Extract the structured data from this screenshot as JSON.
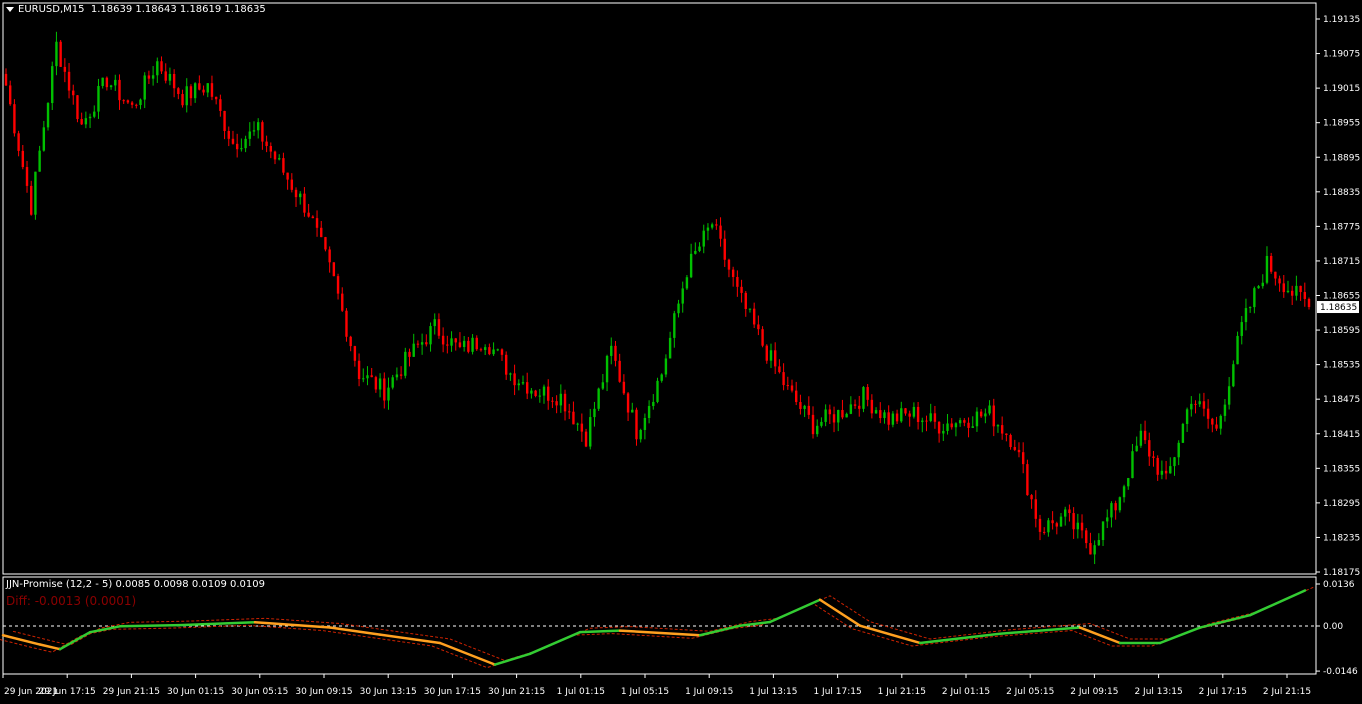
{
  "chart": {
    "symbol_line": "EURUSD,M15  1.18639 1.18643 1.18619 1.18635",
    "current_price_label": "1.18635",
    "price_axis_labels": [
      "1.19135",
      "1.19075",
      "1.19015",
      "1.18955",
      "1.18895",
      "1.18835",
      "1.18775",
      "1.18715",
      "1.18655",
      "1.18595",
      "1.18535",
      "1.18475",
      "1.18415",
      "1.18355",
      "1.18295",
      "1.18235",
      "1.18175"
    ],
    "time_axis_labels": [
      "29 Jun 2021",
      "29 Jun 17:15",
      "29 Jun 21:15",
      "30 Jun 01:15",
      "30 Jun 05:15",
      "30 Jun 09:15",
      "30 Jun 13:15",
      "30 Jun 17:15",
      "30 Jun 21:15",
      "1 Jul 01:15",
      "1 Jul 05:15",
      "1 Jul 09:15",
      "1 Jul 13:15",
      "1 Jul 17:15",
      "1 Jul 21:15",
      "2 Jul 01:15",
      "2 Jul 05:15",
      "2 Jul 09:15",
      "2 Jul 13:15",
      "2 Jul 17:15",
      "2 Jul 21:15"
    ],
    "colors": {
      "bull": "#00c000",
      "bear": "#ff0000",
      "background": "#000000",
      "axis": "#ffffff"
    },
    "price_range": [
      1.18175,
      1.19135
    ]
  },
  "indicator": {
    "title": "JJN-Promise (12,2 - 5) 0.0085 0.0098 0.0109 0.0109",
    "diff_text": "Diff: -0.0013 (0.0001)",
    "axis_labels": [
      "0.0136",
      "0.00",
      "-0.0146"
    ],
    "colors": {
      "up": "#33cc33",
      "down": "#ffa020",
      "signal": "#cc2200",
      "zero": "#ffffff"
    }
  },
  "chart_data": {
    "type": "candlestick",
    "title": "EURUSD,M15",
    "ylim": [
      1.18175,
      1.19135
    ],
    "anchors": [
      [
        0,
        1.1902
      ],
      [
        6,
        1.1881
      ],
      [
        12,
        1.1909
      ],
      [
        18,
        1.1895
      ],
      [
        24,
        1.1903
      ],
      [
        30,
        1.1898
      ],
      [
        36,
        1.1906
      ],
      [
        42,
        1.19
      ],
      [
        48,
        1.1902
      ],
      [
        54,
        1.1892
      ],
      [
        60,
        1.1894
      ],
      [
        66,
        1.1887
      ],
      [
        72,
        1.188
      ],
      [
        78,
        1.1868
      ],
      [
        84,
        1.1852
      ],
      [
        90,
        1.1849
      ],
      [
        96,
        1.1855
      ],
      [
        102,
        1.186
      ],
      [
        108,
        1.1856
      ],
      [
        114,
        1.1858
      ],
      [
        120,
        1.1852
      ],
      [
        126,
        1.1849
      ],
      [
        132,
        1.1848
      ],
      [
        138,
        1.1841
      ],
      [
        144,
        1.1856
      ],
      [
        150,
        1.1842
      ],
      [
        156,
        1.1852
      ],
      [
        162,
        1.187
      ],
      [
        168,
        1.1878
      ],
      [
        174,
        1.1866
      ],
      [
        180,
        1.1857
      ],
      [
        186,
        1.1849
      ],
      [
        192,
        1.1843
      ],
      [
        198,
        1.1845
      ],
      [
        204,
        1.1848
      ],
      [
        210,
        1.1844
      ],
      [
        216,
        1.1845
      ],
      [
        222,
        1.1843
      ],
      [
        228,
        1.1844
      ],
      [
        234,
        1.1845
      ],
      [
        240,
        1.184
      ],
      [
        246,
        1.1825
      ],
      [
        252,
        1.1827
      ],
      [
        258,
        1.1822
      ],
      [
        264,
        1.1829
      ],
      [
        270,
        1.1841
      ],
      [
        276,
        1.1833
      ],
      [
        282,
        1.1848
      ],
      [
        288,
        1.1842
      ],
      [
        294,
        1.186
      ],
      [
        300,
        1.1871
      ],
      [
        306,
        1.1866
      ],
      [
        310,
        1.1864
      ]
    ]
  }
}
